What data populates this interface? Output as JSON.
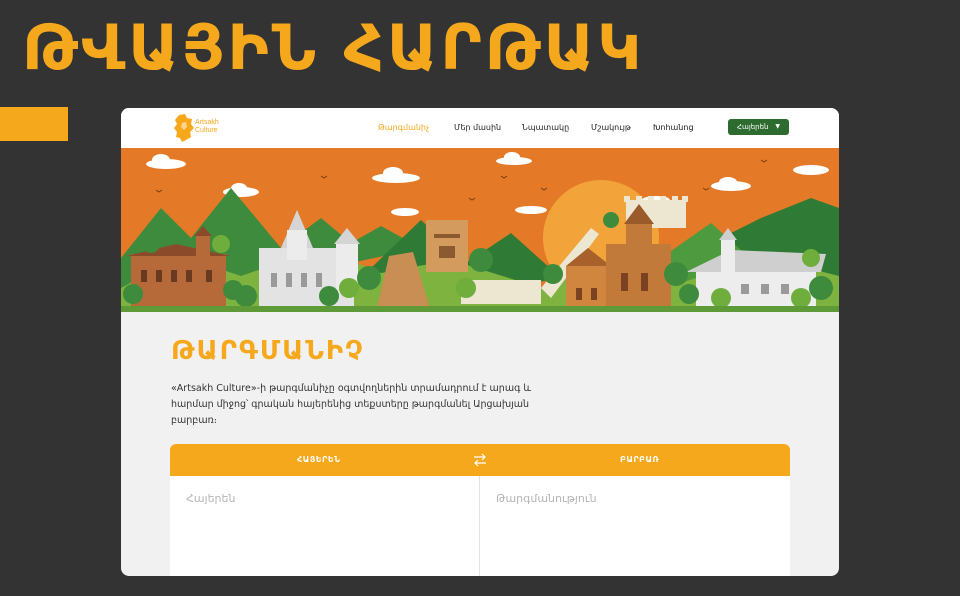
{
  "hero": {
    "title": "ԹՎԱՅԻՆ ՀԱՐԹԱԿ"
  },
  "logo": {
    "line1": "Artsakh",
    "line2": "Culture"
  },
  "nav": {
    "items": [
      {
        "label": "Թարգմանիչ",
        "active": true
      },
      {
        "label": "Մեր մասին",
        "active": false
      },
      {
        "label": "Նպատակը",
        "active": false
      },
      {
        "label": "Մշակույթ",
        "active": false
      },
      {
        "label": "Խոհանոց",
        "active": false
      }
    ],
    "language_button": "Հայերեն",
    "language_caret": "▼"
  },
  "content": {
    "title": "ԹԱՐԳՄԱՆԻՉ",
    "description": "«Artsakh Culture»-ի թարգմանիչը օգտվողներին տրամադրում է արագ և հարմար միջոց՝ գրական հայերենից տեքստերը թարգմանել Արցախյան բարբառ։"
  },
  "translator": {
    "source_lang": "ՀԱՅԵՐԵՆ",
    "target_lang": "ԲԱՐԲԱՌ",
    "source_placeholder": "Հայերեն",
    "target_placeholder": "Թարգմանություն"
  },
  "colors": {
    "accent": "#F6A81D",
    "background": "#333333",
    "nav_button": "#2E6B2F",
    "banner_sky": "#E47A27"
  },
  "icons": {
    "swap": "swap-arrows-icon",
    "logo": "artsakh-map-icon"
  }
}
